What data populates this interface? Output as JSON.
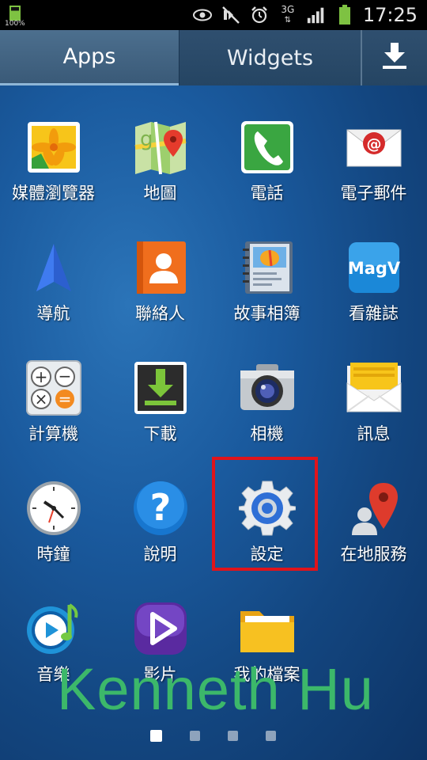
{
  "status_bar": {
    "battery_percent": "100%",
    "network_label": "3G",
    "time": "17:25",
    "icons": [
      "battery-icon",
      "eye-icon",
      "mute-icon",
      "alarm-icon",
      "network-3g-icon",
      "signal-icon",
      "battery-full-icon"
    ]
  },
  "tabs": {
    "apps": "Apps",
    "widgets": "Widgets",
    "download_icon": "download-icon"
  },
  "apps": [
    {
      "label": "媒體瀏覽器",
      "icon": "gallery-icon"
    },
    {
      "label": "地圖",
      "icon": "maps-icon"
    },
    {
      "label": "電話",
      "icon": "phone-icon"
    },
    {
      "label": "電子郵件",
      "icon": "email-icon"
    },
    {
      "label": "導航",
      "icon": "navigation-icon"
    },
    {
      "label": "聯絡人",
      "icon": "contacts-icon"
    },
    {
      "label": "故事相簿",
      "icon": "story-album-icon"
    },
    {
      "label": "看雜誌",
      "icon": "magazine-icon"
    },
    {
      "label": "計算機",
      "icon": "calculator-icon"
    },
    {
      "label": "下載",
      "icon": "downloads-icon"
    },
    {
      "label": "相機",
      "icon": "camera-icon"
    },
    {
      "label": "訊息",
      "icon": "messages-icon"
    },
    {
      "label": "時鐘",
      "icon": "clock-icon"
    },
    {
      "label": "說明",
      "icon": "help-icon"
    },
    {
      "label": "設定",
      "icon": "settings-icon"
    },
    {
      "label": "在地服務",
      "icon": "local-icon"
    },
    {
      "label": "音樂",
      "icon": "music-icon"
    },
    {
      "label": "影片",
      "icon": "video-icon"
    },
    {
      "label": "我的檔案",
      "icon": "my-files-icon"
    }
  ],
  "magazine_text": "MagV",
  "watermark": "Kenneth Hu",
  "page_indicator": {
    "current": 1,
    "total": 4
  },
  "colors": {
    "highlight": "#e0141b",
    "watermark": "#3cb86a"
  }
}
